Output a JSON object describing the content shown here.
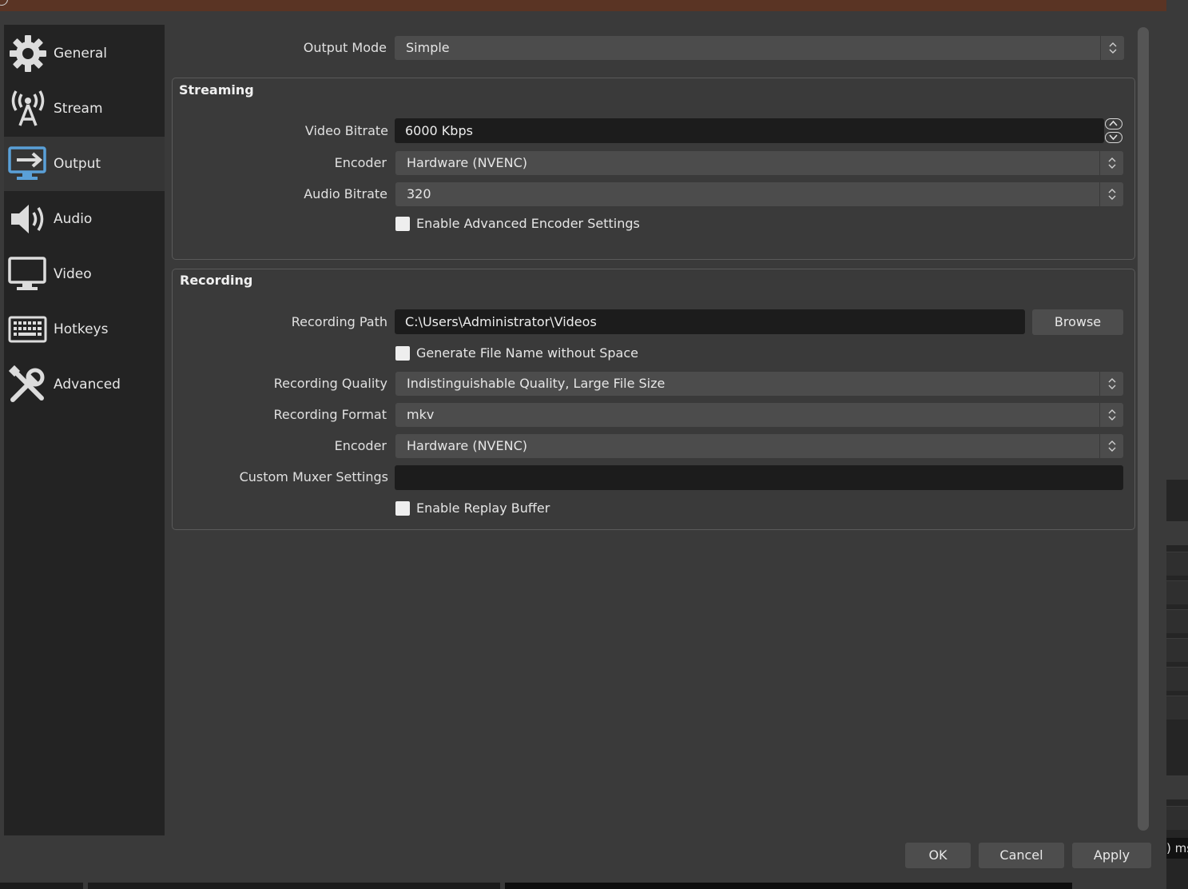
{
  "sidebar": {
    "items": [
      {
        "label": "General",
        "icon": "gear-icon"
      },
      {
        "label": "Stream",
        "icon": "antenna-icon"
      },
      {
        "label": "Output",
        "icon": "output-monitor-icon",
        "active": true
      },
      {
        "label": "Audio",
        "icon": "speaker-icon"
      },
      {
        "label": "Video",
        "icon": "monitor-icon"
      },
      {
        "label": "Hotkeys",
        "icon": "keyboard-icon"
      },
      {
        "label": "Advanced",
        "icon": "tools-icon"
      }
    ]
  },
  "output_mode": {
    "label": "Output Mode",
    "value": "Simple"
  },
  "streaming": {
    "title": "Streaming",
    "video_bitrate": {
      "label": "Video Bitrate",
      "value": "6000 Kbps"
    },
    "encoder": {
      "label": "Encoder",
      "value": "Hardware (NVENC)"
    },
    "audio_bitrate": {
      "label": "Audio Bitrate",
      "value": "320"
    },
    "advanced_encoder": {
      "label": "Enable Advanced Encoder Settings"
    }
  },
  "recording": {
    "title": "Recording",
    "path": {
      "label": "Recording Path",
      "value": "C:\\Users\\Administrator\\Videos"
    },
    "browse_label": "Browse",
    "no_space": {
      "label": "Generate File Name without Space"
    },
    "quality": {
      "label": "Recording Quality",
      "value": "Indistinguishable Quality, Large File Size"
    },
    "format": {
      "label": "Recording Format",
      "value": "mkv"
    },
    "encoder": {
      "label": "Encoder",
      "value": "Hardware (NVENC)"
    },
    "muxer": {
      "label": "Custom Muxer Settings",
      "value": ""
    },
    "replay_buffer": {
      "label": "Enable Replay Buffer"
    }
  },
  "buttons": {
    "ok": "OK",
    "cancel": "Cancel",
    "apply": "Apply"
  },
  "background": {
    "ms_text": ") ms"
  },
  "colors": {
    "panel": "#3a3a3a",
    "sidebar": "#232323",
    "active_item": "#353535",
    "input_dark": "#1c1c1c",
    "combo": "#4c4c4c",
    "titlebar": "#5a3424"
  }
}
